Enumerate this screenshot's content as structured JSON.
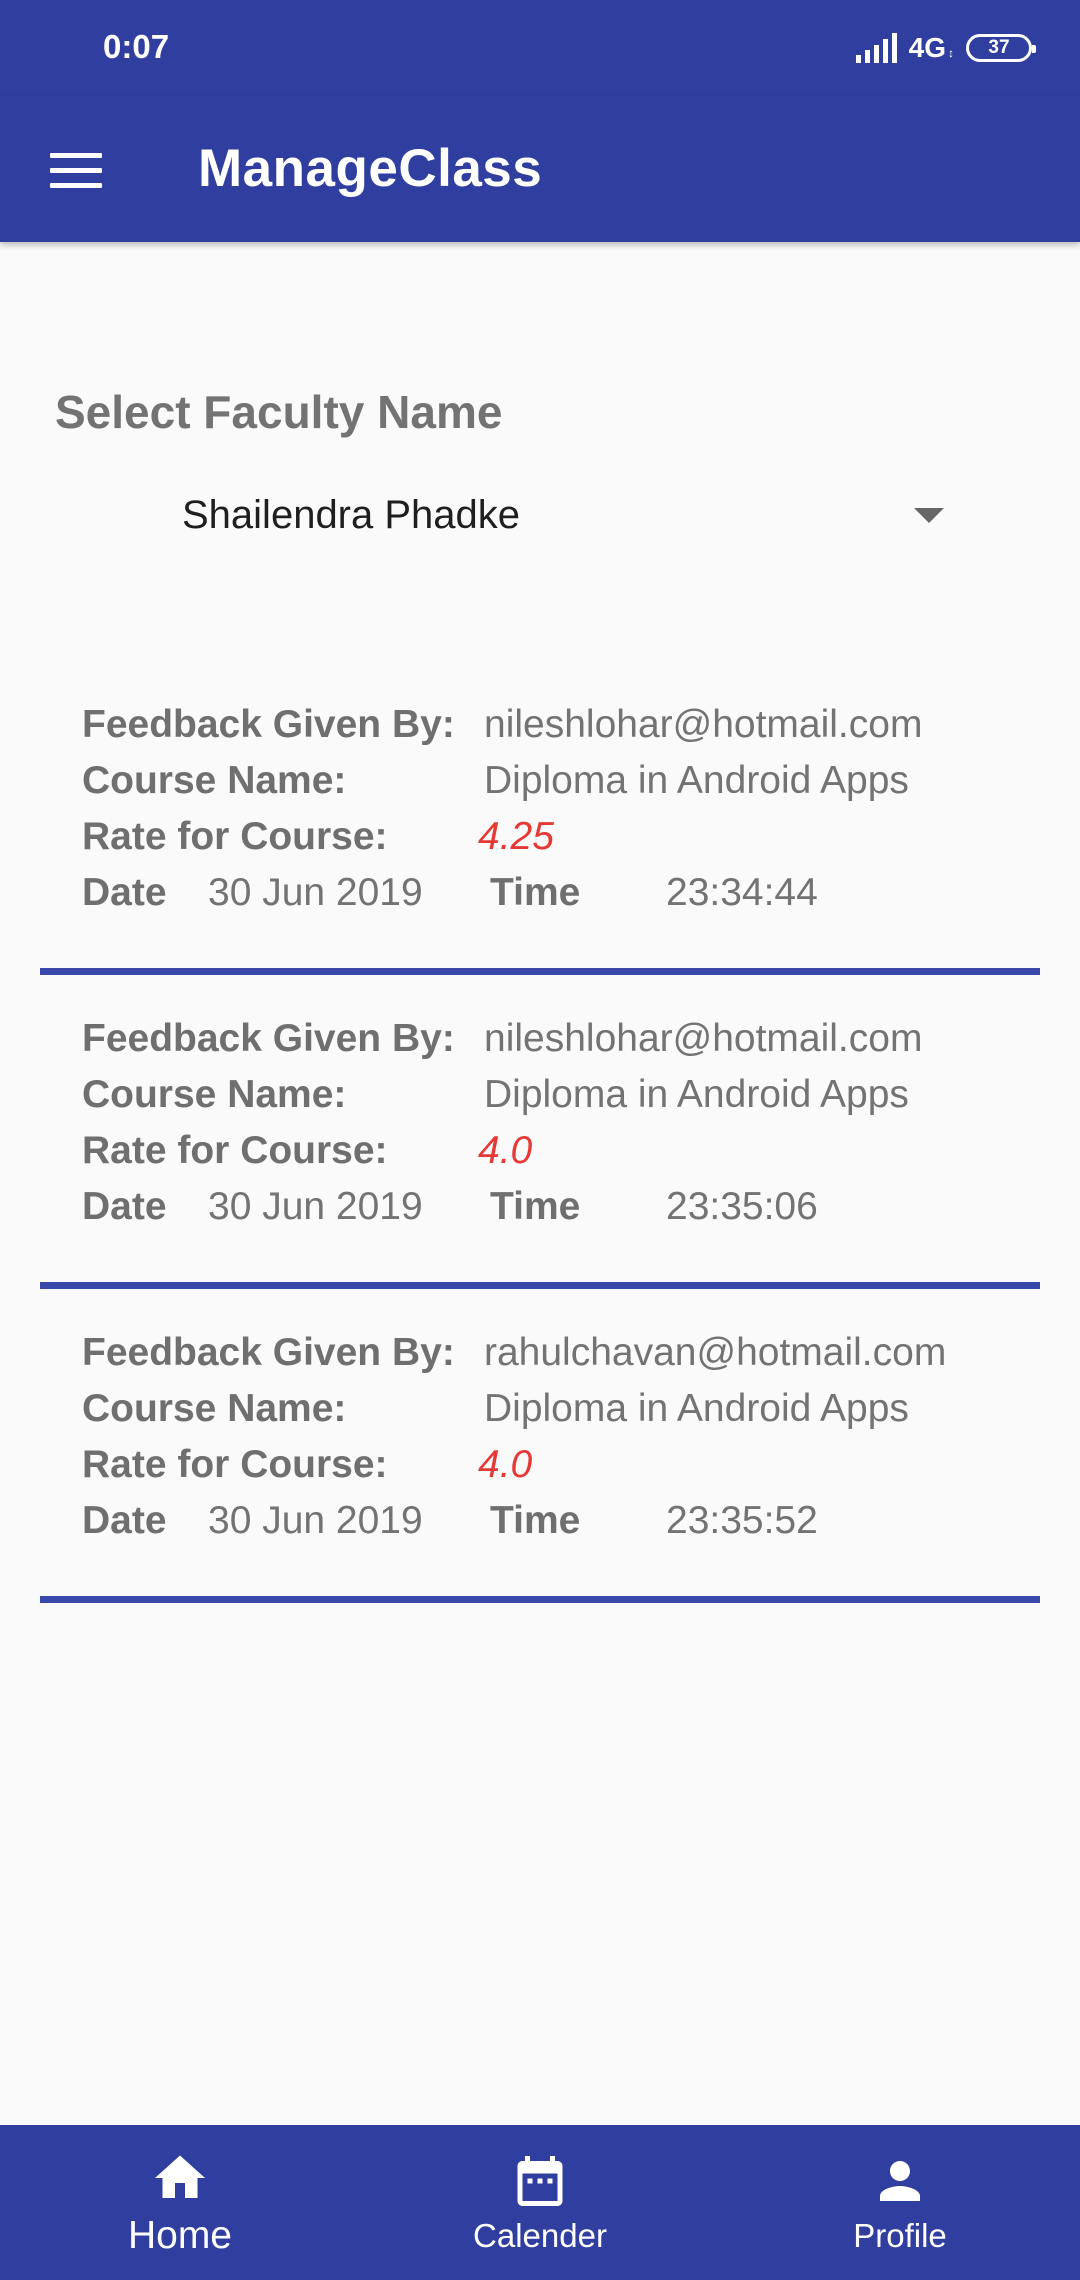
{
  "status_bar": {
    "time": "0:07",
    "network": "4G",
    "battery": "37"
  },
  "app_bar": {
    "title": "ManageClass",
    "menu_icon": "hamburger-menu-icon"
  },
  "faculty": {
    "label": "Select Faculty Name",
    "selected": "Shailendra Phadke"
  },
  "labels": {
    "feedback_by": "Feedback Given By:",
    "course_name": "Course Name:",
    "rate": "Rate for Course:",
    "date": "Date",
    "time": "Time"
  },
  "feedbacks": [
    {
      "email": "nileshlohar@hotmail.com",
      "course": "Diploma in Android Apps",
      "rating": "4.25",
      "date": "30 Jun 2019",
      "time": "23:34:44"
    },
    {
      "email": "nileshlohar@hotmail.com",
      "course": "Diploma in Android Apps",
      "rating": "4.0",
      "date": "30 Jun 2019",
      "time": "23:35:06"
    },
    {
      "email": "rahulchavan@hotmail.com",
      "course": "Diploma in Android Apps",
      "rating": "4.0",
      "date": "30 Jun 2019",
      "time": "23:35:52"
    }
  ],
  "bottom_nav": [
    {
      "label": "Home",
      "icon": "home-icon",
      "active": true
    },
    {
      "label": "Calender",
      "icon": "calendar-icon",
      "active": false
    },
    {
      "label": "Profile",
      "icon": "person-icon",
      "active": false
    }
  ],
  "colors": {
    "primary": "#303f9f",
    "divider": "#3949ab",
    "rating": "#e53935"
  }
}
